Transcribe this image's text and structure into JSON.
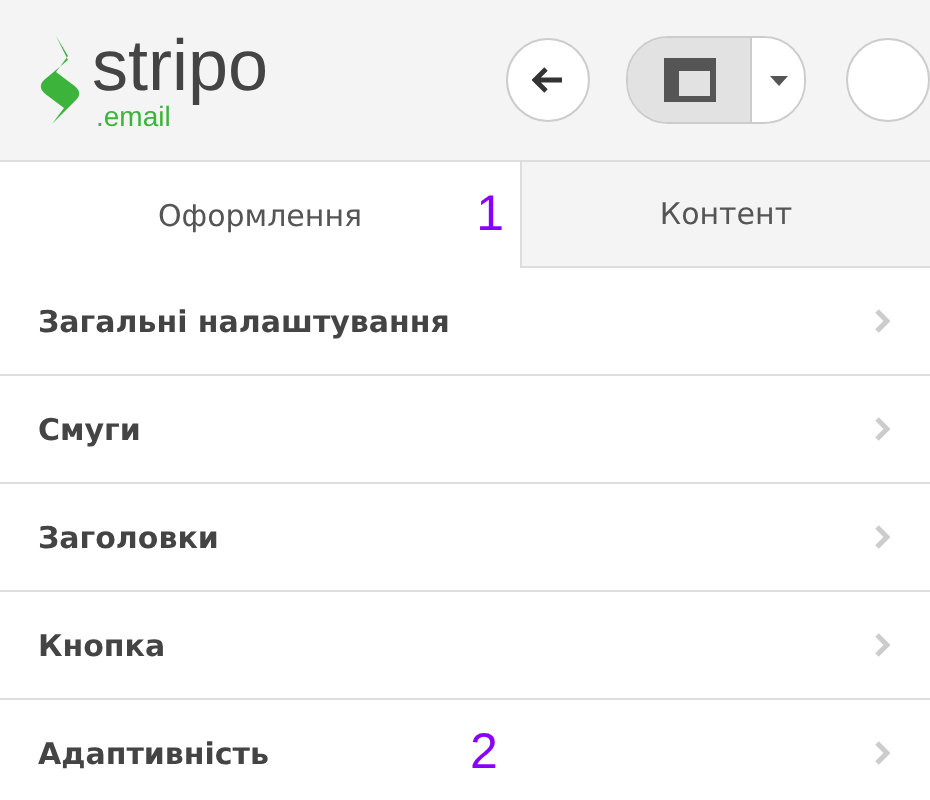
{
  "logo": {
    "name": "stripo",
    "domain": ".email"
  },
  "tabs": [
    {
      "label": "Оформлення",
      "selected": true,
      "marker": "1"
    },
    {
      "label": "Контент",
      "selected": false
    }
  ],
  "settings": [
    {
      "label": "Загальні налаштування"
    },
    {
      "label": "Смуги"
    },
    {
      "label": "Заголовки"
    },
    {
      "label": "Кнопка"
    },
    {
      "label": "Адаптивність",
      "marker": "2"
    }
  ]
}
